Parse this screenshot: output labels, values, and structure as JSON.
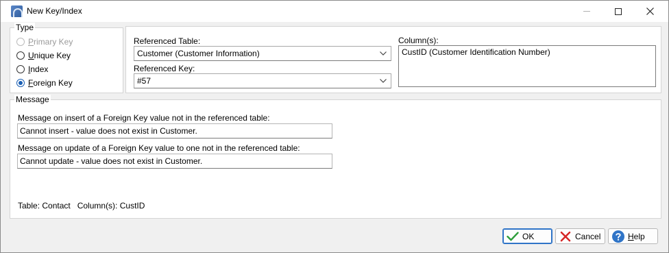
{
  "window": {
    "title": "New Key/Index"
  },
  "type_group": {
    "legend": "Type",
    "options": [
      {
        "label": "Primary Key",
        "accel": "P",
        "rest": "rimary Key",
        "state": "disabled"
      },
      {
        "label": "Unique Key",
        "accel": "U",
        "rest": "nique Key",
        "state": "unchecked"
      },
      {
        "label": "Index",
        "accel": "I",
        "rest": "ndex",
        "state": "unchecked"
      },
      {
        "label": "Foreign Key",
        "accel": "F",
        "rest": "oreign Key",
        "state": "checked"
      }
    ]
  },
  "reference": {
    "table_label": "Referenced Table:",
    "table_value": "Customer  (Customer Information)",
    "key_label": "Referenced Key:",
    "key_value": "#57",
    "columns_label": "Column(s):",
    "columns_items": [
      "CustID  (Customer Identification Number)"
    ]
  },
  "message_group": {
    "legend": "Message",
    "insert_label": "Message on insert of a Foreign Key value not in the referenced table:",
    "insert_value": "Cannot insert - value does not exist in Customer.",
    "update_label": "Message on update of a Foreign Key value to one not in the referenced table:",
    "update_value": "Cannot update - value does not exist in Customer.",
    "footer": "Table: Contact   Column(s): CustID"
  },
  "buttons": {
    "ok": "OK",
    "cancel": "Cancel",
    "help_accel": "H",
    "help_rest": "elp"
  },
  "colors": {
    "accent": "#1a5fb4",
    "ok_check": "#2e9e3c",
    "cancel_x": "#d62828",
    "help_circle": "#2f74c7"
  },
  "icons": {
    "app": "app-icon",
    "ok": "checkmark-icon",
    "cancel": "red-x-icon",
    "help": "help-icon"
  }
}
